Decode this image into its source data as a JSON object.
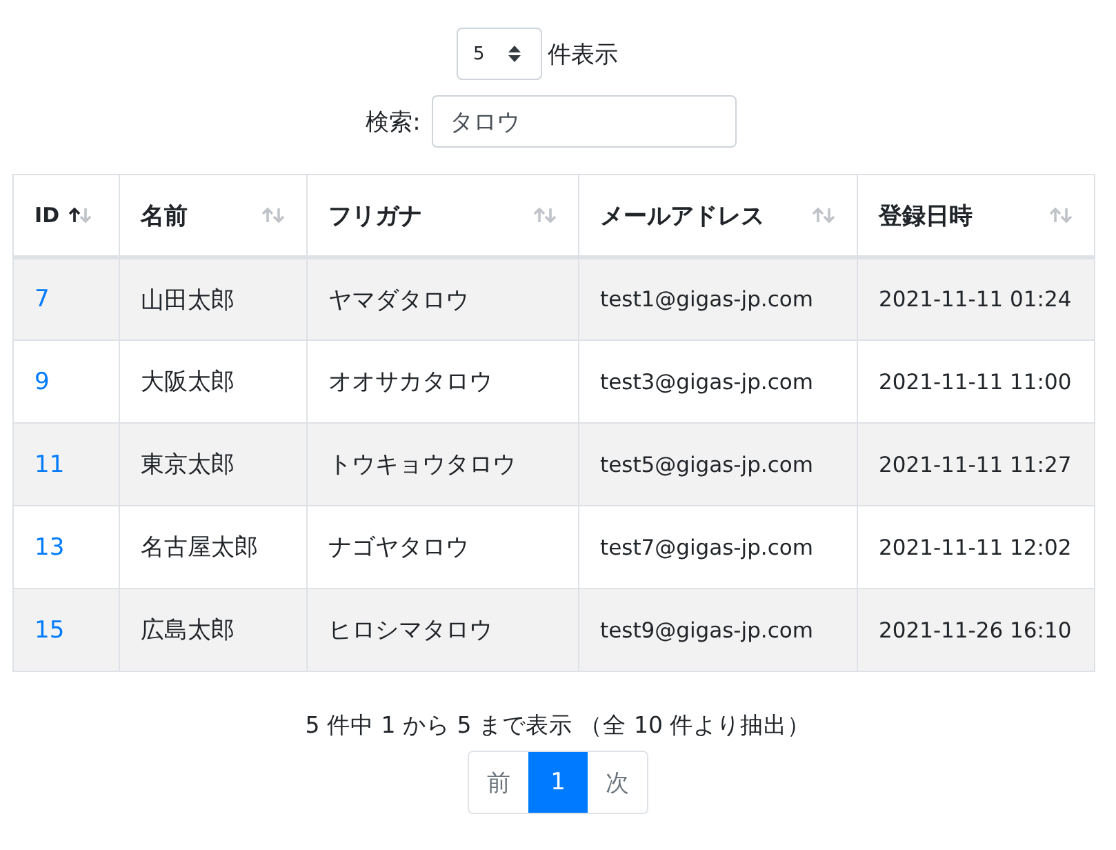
{
  "length_menu": {
    "value": "5",
    "label": "件表示"
  },
  "search": {
    "label": "検索:",
    "value": "タロウ"
  },
  "table": {
    "columns": [
      {
        "label": "ID",
        "sorted_ascending": true
      },
      {
        "label": "名前",
        "sorted_ascending": false
      },
      {
        "label": "フリガナ",
        "sorted_ascending": false
      },
      {
        "label": "メールアドレス",
        "sorted_ascending": false
      },
      {
        "label": "登録日時",
        "sorted_ascending": false
      }
    ],
    "rows": [
      [
        "7",
        "山田太郎",
        "ヤマダタロウ",
        "test1@gigas-jp.com",
        "2021-11-11 01:24"
      ],
      [
        "9",
        "大阪太郎",
        "オオサカタロウ",
        "test3@gigas-jp.com",
        "2021-11-11 11:00"
      ],
      [
        "11",
        "東京太郎",
        "トウキョウタロウ",
        "test5@gigas-jp.com",
        "2021-11-11 11:27"
      ],
      [
        "13",
        "名古屋太郎",
        "ナゴヤタロウ",
        "test7@gigas-jp.com",
        "2021-11-11 12:02"
      ],
      [
        "15",
        "広島太郎",
        "ヒロシマタロウ",
        "test9@gigas-jp.com",
        "2021-11-26 16:10"
      ]
    ]
  },
  "info": "5 件中 1 から 5 まで表示 （全 10 件より抽出）",
  "pagination": [
    {
      "label": "前",
      "selected": false,
      "disabled": true
    },
    {
      "label": "1",
      "selected": true,
      "disabled": false
    },
    {
      "label": "次",
      "selected": false,
      "disabled": true
    }
  ]
}
